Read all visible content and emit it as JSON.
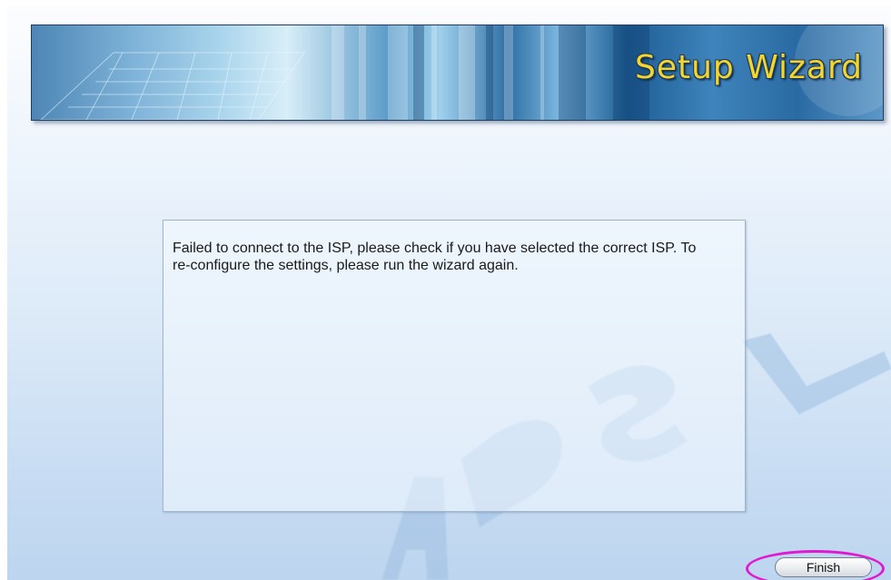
{
  "banner": {
    "title": "Setup Wizard"
  },
  "watermark": {
    "text": "ADSL"
  },
  "message": {
    "text": "Failed to connect to the ISP, please check if you have selected the correct ISP. To re-configure the settings, please run the wizard again."
  },
  "actions": {
    "finish_label": "Finish"
  },
  "colors": {
    "banner_title": "#f4d52c",
    "highlight_ring": "#e01ad2"
  }
}
